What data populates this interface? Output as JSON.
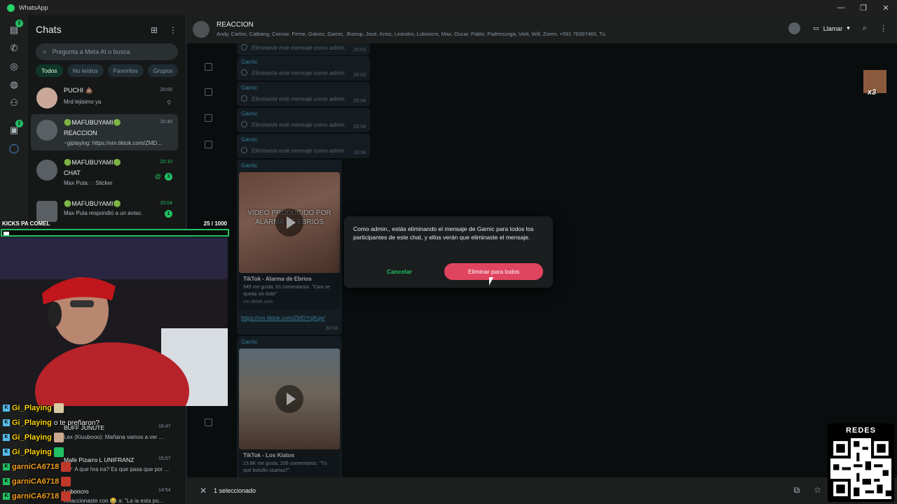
{
  "window": {
    "title": "WhatsApp"
  },
  "rail": {
    "badges": {
      "chats": "2",
      "communities": "2"
    }
  },
  "chatlist": {
    "title": "Chats",
    "search_placeholder": "Pregunta a Meta AI o busca",
    "filters": [
      "Todos",
      "No leídos",
      "Favoritos",
      "Grupos"
    ],
    "items": [
      {
        "name": "PUCHI 💩",
        "msg": "Mrd lejisimo ya",
        "time": "20:00"
      },
      {
        "name": "🟢MAFUBUYAMI🟢",
        "name2": "REACCION",
        "msg": "~giplaying: https://vm.tiktok.com/ZMD...",
        "time": "20:40"
      },
      {
        "name": "🟢MAFUBUYAMI🟢",
        "name2": "CHAT",
        "msg": "Max Puta: ◌ Sticker",
        "time": "20:10",
        "unread": "3",
        "mention": "@"
      },
      {
        "name": "🟢MAFUBUYAMI🟢",
        "msg": "Max Puta respondió a un aviso.",
        "time": "20:04",
        "unread": "1"
      }
    ],
    "lower_items": [
      {
        "name": "BUFF JUNUTE",
        "msg": "Lex (Kiuubooo): Mañana vamos a ver ...",
        "time": "16:47"
      },
      {
        "name": "Mafe Pizarro L UNIFRANZ",
        "msg": "✓✓ A que hra ira? Es que pasa que por ...",
        "time": "15:57"
      },
      {
        "name": "Luboncro",
        "msg": "Reaccionaste con 😂 a: \"La ia esta po...",
        "time": "14:54"
      }
    ]
  },
  "conversation": {
    "title": "REACCION",
    "members": "Andy, Carlos, Catbang, Connor, Firme, Galvez, Garnic, Jhonsp, José, Kriss, Leandro, Luboncro, Max, Oscar, Pablo, Padresunga, Vielt, Will, Zoren, +591 76397465, Tú",
    "call_label": "Llamar",
    "deleted_messages": [
      {
        "sender": "",
        "text": "Eliminaste este mensaje como admin.",
        "time": "20:03"
      },
      {
        "sender": "Garnic",
        "text": "Eliminaste este mensaje como admin.",
        "time": "20:03"
      },
      {
        "sender": "Garnic",
        "text": "Eliminaste este mensaje como admin.",
        "time": "20:04"
      },
      {
        "sender": "Garnic",
        "text": "Eliminaste este mensaje como admin.",
        "time": "20:04"
      },
      {
        "sender": "Garnic",
        "text": "Eliminaste este mensaje como admin.",
        "time": "20:04"
      }
    ],
    "media_messages": [
      {
        "sender": "Garnic",
        "overlay": "VIDEO PRODUCIDO POR ALARMA DE EBRIOS",
        "card_title": "TikTok - Alarma de Ebrios",
        "card_desc": "949 me gusta, 61 comentarios. \"Casi se queda sin bolo\"",
        "card_domain": "vm.tiktok.com",
        "url": "https://vm.tiktok.com/ZMDYsjKqv/",
        "time": "20:04"
      },
      {
        "sender": "Garnic",
        "card_title": "TikTok - Los Kiatos",
        "card_desc": "13.8K me gusta, 206 comentarios. \"Tú que bolsillo usarías?\""
      }
    ]
  },
  "dialog": {
    "text": "Como admin., estás eliminando el mensaje de Garnic para todos los participantes de este chat, y ellos verán que eliminaste el mensaje.",
    "cancel": "Cancelar",
    "confirm": "Eliminar para todos"
  },
  "selection_bar": {
    "text": "1 seleccionado"
  },
  "stream": {
    "kicks_label": "KICKS PA COMEL",
    "kicks_count": "25  / 1000",
    "kicks_progress": 0.025,
    "chat": [
      {
        "user": "Gi_Playing",
        "msg": ""
      },
      {
        "user": "Gi_Playing",
        "msg": "o te preñaron?"
      },
      {
        "user": "Gi_Playing",
        "msg": ""
      },
      {
        "user": "Gi_Playing",
        "msg": ""
      },
      {
        "user": "garniCA6718",
        "msg": ""
      },
      {
        "user": "garniCA6718",
        "msg": ""
      },
      {
        "user": "garniCA6718",
        "msg": ""
      }
    ],
    "reaction_multiplier": "x3",
    "qr_title": "REDES"
  },
  "colors": {
    "accent": "#21c063",
    "danger": "#e0455f",
    "link": "#53bdeb"
  }
}
